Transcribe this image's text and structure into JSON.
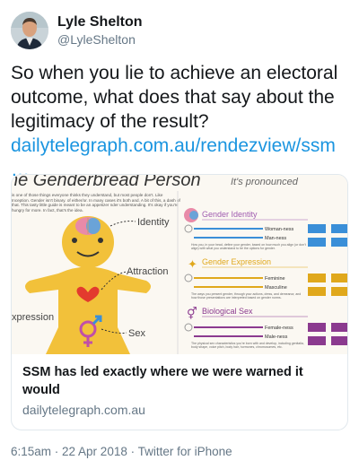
{
  "tweet": {
    "author_name": "Lyle Shelton",
    "author_handle": "@LyleShelton",
    "text": "So when you lie to achieve an electoral outcome, what does that say about the legitimacy of the result?",
    "link": "dailytelegraph.com.au/rendezview/ssm",
    "link_ellipsis": "…",
    "timestamp": "6:15am · 22 Apr 2018 · Twitter for iPhone"
  },
  "card": {
    "title": "SSM has led exactly where we were warned it would",
    "domain": "dailytelegraph.com.au",
    "image": {
      "heading": "he Genderbread Person",
      "subheading": "It's pronounced",
      "intro": "is one of those things everyone thinks they understand, but most people don't. Like Inception. Gender isn't binary. of either/or. In many cases it's both and. A bit of this, a dash of that. This tasty little guide is meant to be an appetizer nder understanding. It's okay if you're hungry for more. In fact, that's the idea.",
      "labels": {
        "identity": "Identity",
        "attraction": "Attraction",
        "expression": "xpression",
        "sex": "Sex"
      },
      "sections": [
        {
          "title": "Gender Identity",
          "color": "#a05cb0",
          "lines": [
            "Woman-ness",
            "Man-ness"
          ],
          "desc": "How you, in your head, define your gender, based on how much you align (or don't align) with what you understand to be the options for gender."
        },
        {
          "title": "Gender Expression",
          "color": "#e0a81c",
          "lines": [
            "Feminine",
            "Masculine"
          ],
          "desc": "The ways you present gender, through your actions, dress, and demeanor, and how those presentations are interpreted based on gender norms."
        },
        {
          "title": "Biological Sex",
          "color": "#8b3a8f",
          "lines": [
            "Female-ness",
            "Male-ness"
          ],
          "desc": "The physical sex characteristics you're born with and develop, including genitalia, body shape, voice pitch, body hair, hormones, chromosomes, etc."
        }
      ]
    }
  },
  "colors": {
    "link": "#1b95e0",
    "muted": "#657786"
  }
}
